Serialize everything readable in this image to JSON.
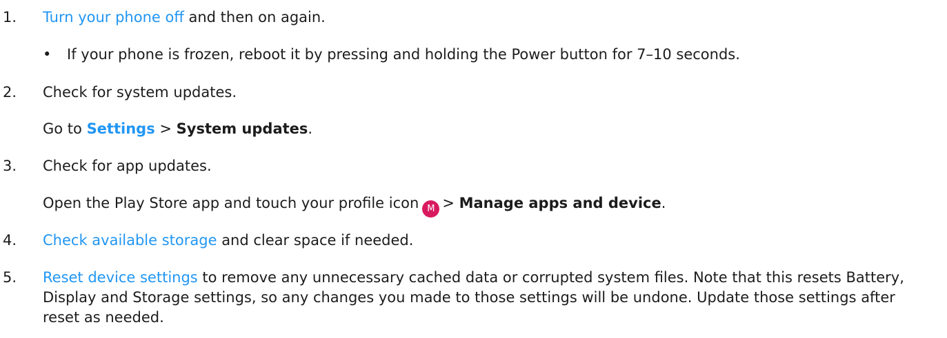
{
  "steps": [
    {
      "number": "1.",
      "link": "Turn your phone off",
      "text": " and then on again.",
      "sub_bullet": "If your phone is frozen, reboot it by pressing and holding the Power button for 7–10 seconds."
    },
    {
      "number": "2.",
      "text": "Check for system updates.",
      "detail": {
        "prefix": "Go to ",
        "settings_link": "Settings",
        "separator": " > ",
        "target": "System updates",
        "suffix": "."
      }
    },
    {
      "number": "3.",
      "text": "Check for app updates.",
      "detail": {
        "prefix": "Open the Play Store app and touch your profile icon",
        "avatar_letter": "M",
        "separator": "> ",
        "target": "Manage apps and device",
        "suffix": "."
      }
    },
    {
      "number": "4.",
      "link": "Check available storage",
      "text": " and clear space if needed."
    },
    {
      "number": "5.",
      "link": "Reset device settings",
      "text": " to remove any unnecessary cached data or corrupted system files. Note that this resets Battery, Display and Storage settings, so any changes you made to those settings will be undone. Update those settings after reset as needed."
    }
  ],
  "bullet_symbol": "•",
  "colors": {
    "link": "#2196f3",
    "text": "#1c1c1c",
    "avatar_bg": "#d81b60"
  },
  "icons": {
    "profile": "profile-avatar-icon"
  }
}
